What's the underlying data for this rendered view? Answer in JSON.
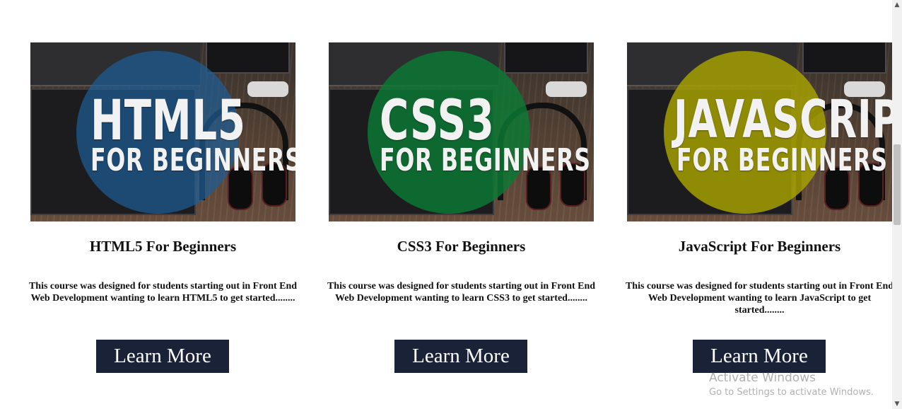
{
  "courses": [
    {
      "thumb_big": "HTML5",
      "thumb_small": "FOR BEGINNERS",
      "title": "HTML5 For Beginners",
      "description": "This course was designed for students starting out in Front End Web Development wanting to learn HTML5 to get started........",
      "button_label": "Learn More",
      "accent_color": "#1f5d94"
    },
    {
      "thumb_big": "CSS3",
      "thumb_small": "FOR BEGINNERS",
      "title": "CSS3 For Beginners",
      "description": "This course was designed for students starting out in Front End Web Development wanting to learn CSS3 to get started........",
      "button_label": "Learn More",
      "accent_color": "#0b7a35"
    },
    {
      "thumb_big": "JAVASCRIPT",
      "thumb_small": "FOR BEGINNERS",
      "title": "JavaScript For Beginners",
      "description": "This course was designed for students starting out in Front End Web Development wanting to learn JavaScript to get started........",
      "button_label": "Learn More",
      "accent_color": "#a8a400"
    }
  ],
  "button_color": "#1a2238",
  "watermark": {
    "line1": "Activate Windows",
    "line2": "Go to Settings to activate Windows."
  },
  "scrollbar": {
    "up_icon": "triangle-up",
    "down_icon": "triangle-down"
  }
}
